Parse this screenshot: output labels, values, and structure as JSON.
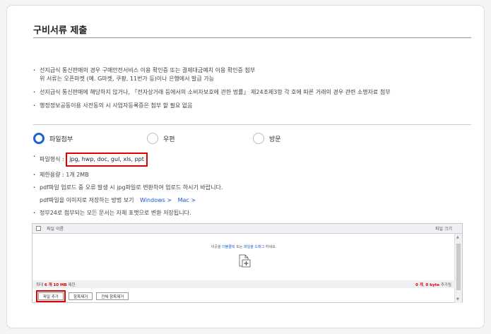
{
  "section_title": "구비서류 제출",
  "notes": [
    {
      "line1": "선지급식 통신판매의 경우 구매안전서비스 이용 확인증 또는 결제대금예치 이용 확인증 첨부",
      "line2": "위 서류는 오픈마켓 (예. G마켓, 쿠팡, 11번가 등)이나 은행에서 발급 가능"
    },
    {
      "line1": "선지급식 통신판매에 해당하지 않거나, 「전자상거래 등에서의 소비자보호에 관한 법률」 제24조제3항 각 호에 따른 거래의 경우 관련 소명자료 첨부",
      "line2": ""
    },
    {
      "line1": "행정정보공동이용 사전동의 시 사업자등록증은 첨부 할 필요 없음",
      "line2": ""
    }
  ],
  "radios": [
    {
      "label": "파일첨부",
      "selected": true
    },
    {
      "label": "우편",
      "selected": false
    },
    {
      "label": "방문",
      "selected": false
    }
  ],
  "formats": {
    "type_label": "파일형식 :",
    "types": "jpg, hwp, doc, gul, xls, ppt",
    "limit": "제한용량 : 1개 2MB",
    "pdf_note": "pdf파일 업로드 중 오류 발생 시 jpg파일로 변환하여 업로드 하시기 바랍니다.",
    "pdf_howto": "pdf파일을 이미지로 저장하는 방법 보기",
    "link_windows": "Windows >",
    "link_mac": "Mac >",
    "gov24_note": "정부24로 첨부되는 모든 문서는 자체 포맷으로 변환 저장됩니다."
  },
  "uploader": {
    "col_name": "파일 이름",
    "col_size": "파일 크기",
    "drop_text_pre": "이곳을 ",
    "drop_text_hl1": "더블클릭",
    "drop_text_mid": " 또는 ",
    "drop_text_hl2": "파일을 드래그",
    "drop_text_post": " 하세요.",
    "limit_pre": "최대",
    "limit_count": "6 개",
    "limit_size": "10 MB",
    "limit_post": "제한",
    "added_count": "0 개",
    "added_size": "0 byte",
    "added_post": "추가됨",
    "btn_add": "파일 추가",
    "btn_remove": "항목제거",
    "btn_remove_all": "전체 항목제거"
  },
  "colors": {
    "accent": "#1e63c8",
    "highlight": "#e30000"
  }
}
